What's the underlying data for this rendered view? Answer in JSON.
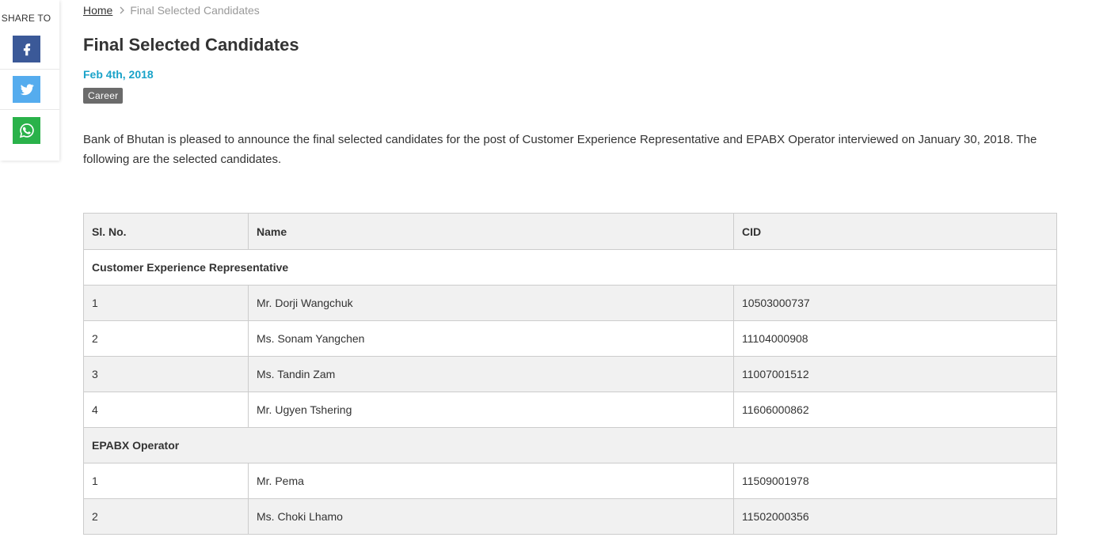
{
  "share": {
    "title": "SHARE TO",
    "buttons": [
      {
        "name": "facebook",
        "icon": "facebook-icon",
        "color": "#3b5998"
      },
      {
        "name": "twitter",
        "icon": "twitter-icon",
        "color": "#55acee"
      },
      {
        "name": "whatsapp",
        "icon": "whatsapp-icon",
        "color": "#2ab24a"
      }
    ]
  },
  "breadcrumb": {
    "home": "Home",
    "current": "Final Selected Candidates"
  },
  "article": {
    "title": "Final Selected Candidates",
    "date": "Feb 4th, 2018",
    "tag": "Career",
    "intro": "Bank of Bhutan is pleased to announce the final selected candidates for the post of Customer Experience Representative and EPABX Operator interviewed on January 30, 2018. The following are the selected candidates."
  },
  "table": {
    "headers": [
      "Sl. No.",
      "Name",
      "CID"
    ],
    "groups": [
      {
        "title": "Customer Experience Representative",
        "rows": [
          {
            "sl": "1",
            "name": "Mr. Dorji Wangchuk",
            "cid": "10503000737"
          },
          {
            "sl": "2",
            "name": "Ms. Sonam Yangchen",
            "cid": "11104000908"
          },
          {
            "sl": "3",
            "name": "Ms. Tandin Zam",
            "cid": "11007001512"
          },
          {
            "sl": "4",
            "name": "Mr. Ugyen Tshering",
            "cid": "11606000862"
          }
        ]
      },
      {
        "title": "EPABX Operator",
        "rows": [
          {
            "sl": "1",
            "name": "Mr. Pema",
            "cid": "11509001978"
          },
          {
            "sl": "2",
            "name": "Ms. Choki Lhamo",
            "cid": "11502000356"
          }
        ]
      }
    ]
  },
  "colors": {
    "accent": "#1aa3c9",
    "tag_bg": "#6b6b6b",
    "row_shade": "#f1f1f1",
    "border": "#cccccc"
  }
}
